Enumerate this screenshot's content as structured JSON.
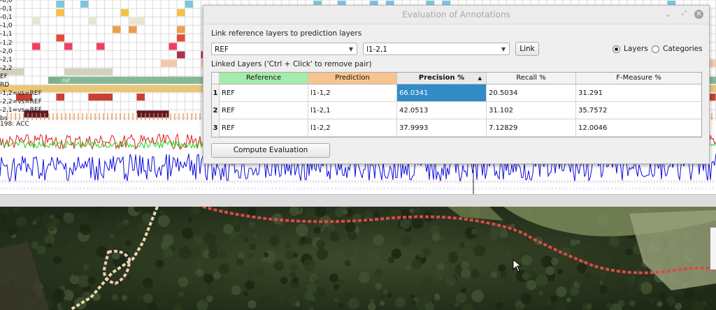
{
  "timeline": {
    "track_labels": [
      "-0,0",
      "-0,1",
      "-0,1",
      "-1,0",
      "-1,1",
      "-1,2",
      "-2,0",
      "-2,1",
      "-2,2",
      "EF",
      "RD",
      "-1,2=vs=REF",
      "-2,2=vs=REF",
      "-2,1=vs=REF",
      "bs",
      "198: ACC"
    ],
    "ref_bar_text": "ref"
  },
  "dialog": {
    "title": "Evaluation of Annotations",
    "link_label": "Link reference layers to prediction layers",
    "reference_combo": "REF",
    "prediction_combo": "l1-2,1",
    "link_button": "Link",
    "radio_layers": "Layers",
    "radio_categories": "Categories",
    "linked_label": "Linked Layers ('Ctrl + Click' to remove pair)",
    "compute_button": "Compute Evaluation",
    "table": {
      "headers": [
        "Reference",
        "Prediction",
        "Precision %",
        "Recall %",
        "F-Measure %"
      ],
      "rows": [
        {
          "num": "1",
          "ref": "REF",
          "pred": "l1-1,2",
          "precision": "66.0341",
          "recall": "20.5034",
          "fmeasure": "31.291"
        },
        {
          "num": "2",
          "ref": "REF",
          "pred": "l1-2,1",
          "precision": "42.0513",
          "recall": "31.102",
          "fmeasure": "35.7572"
        },
        {
          "num": "3",
          "ref": "REF",
          "pred": "l1-2,2",
          "precision": "37.9993",
          "recall": "7.12829",
          "fmeasure": "12.0046"
        }
      ]
    }
  },
  "colors": {
    "reference_header": "#a4ecaa",
    "prediction_header": "#f7c48d",
    "selection": "#308cc6",
    "signal_red": "#e11b1b",
    "signal_green": "#1fd41f",
    "signal_blue": "#0d0de0"
  }
}
